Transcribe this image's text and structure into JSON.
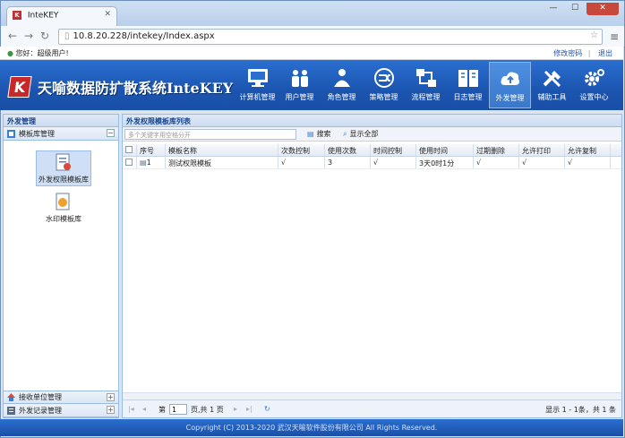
{
  "browser": {
    "tab_title": "InteKEY",
    "url": "10.8.20.228/intekey/Index.aspx"
  },
  "userbar": {
    "greeting": "您好：超级用户!",
    "change_password": "修改密码",
    "logout": "退出"
  },
  "app": {
    "logo_letter": "K",
    "title": "天喻数据防扩散系统InteKEY"
  },
  "nav": [
    {
      "label": "计算机管理",
      "icon": "computer-icon"
    },
    {
      "label": "用户管理",
      "icon": "users-icon"
    },
    {
      "label": "角色管理",
      "icon": "roles-icon"
    },
    {
      "label": "策略管理",
      "icon": "policy-icon"
    },
    {
      "label": "流程管理",
      "icon": "workflow-icon"
    },
    {
      "label": "日志管理",
      "icon": "log-book-icon"
    },
    {
      "label": "外发管理",
      "icon": "outgoing-icon"
    },
    {
      "label": "辅助工具",
      "icon": "tools-icon"
    },
    {
      "label": "设置中心",
      "icon": "settings-gear-icon"
    }
  ],
  "sidebar": {
    "title": "外发管理",
    "sections": [
      {
        "label": "模板库管理"
      },
      {
        "label": "接收单位管理"
      },
      {
        "label": "外发记录管理"
      }
    ],
    "tiles": [
      {
        "label": "外发权限模板库"
      },
      {
        "label": "水印模板库"
      }
    ]
  },
  "main": {
    "title": "外发权限模板库列表",
    "search_placeholder": "多个关键字用空格分开",
    "search_label": "搜索",
    "show_all_label": "显示全部",
    "columns": [
      "序号",
      "模板名称",
      "次数控制",
      "使用次数",
      "时间控制",
      "使用时间",
      "过期删除",
      "允许打印",
      "允许复制"
    ],
    "rows": [
      [
        "1",
        "测试权限模板",
        "√",
        "3",
        "√",
        "3天0时1分",
        "√",
        "√",
        "√"
      ]
    ],
    "pager": {
      "page_label": "第",
      "page_value": "1",
      "of_label": "页,共 1 页",
      "status": "显示 1 - 1条，共 1 条"
    }
  },
  "footer": "Copyright (C) 2013-2020 武汉天喻软件股份有限公司 All Rights Reserved."
}
